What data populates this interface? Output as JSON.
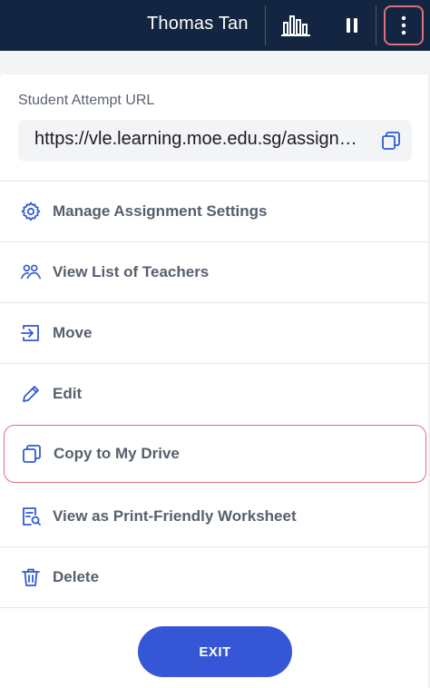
{
  "header": {
    "user_name": "Thomas Tan",
    "stats_icon": "bar-chart-icon",
    "pause_icon": "pause-icon",
    "more_icon": "more-vertical-icon"
  },
  "panel": {
    "url_label": "Student Attempt URL",
    "url_value": "https://vle.learning.moe.edu.sg/assignment/",
    "copy_icon": "copy-icon"
  },
  "menu": {
    "items": [
      {
        "label": "Manage Assignment Settings",
        "icon": "gear-icon"
      },
      {
        "label": "View List of Teachers",
        "icon": "users-icon"
      },
      {
        "label": "Move",
        "icon": "move-into-icon"
      },
      {
        "label": "Edit",
        "icon": "pencil-icon"
      },
      {
        "label": "Copy to My Drive",
        "icon": "copy-icon"
      },
      {
        "label": "View as Print-Friendly Worksheet",
        "icon": "worksheet-search-icon"
      },
      {
        "label": "Delete",
        "icon": "trash-icon"
      }
    ]
  },
  "footer": {
    "exit_label": "EXIT"
  },
  "colors": {
    "header_bg": "#142541",
    "accent_blue": "#3556d6",
    "highlight_border": "#d9727a",
    "menu_text": "#56606d",
    "icon_blue": "#2f5bd3"
  }
}
